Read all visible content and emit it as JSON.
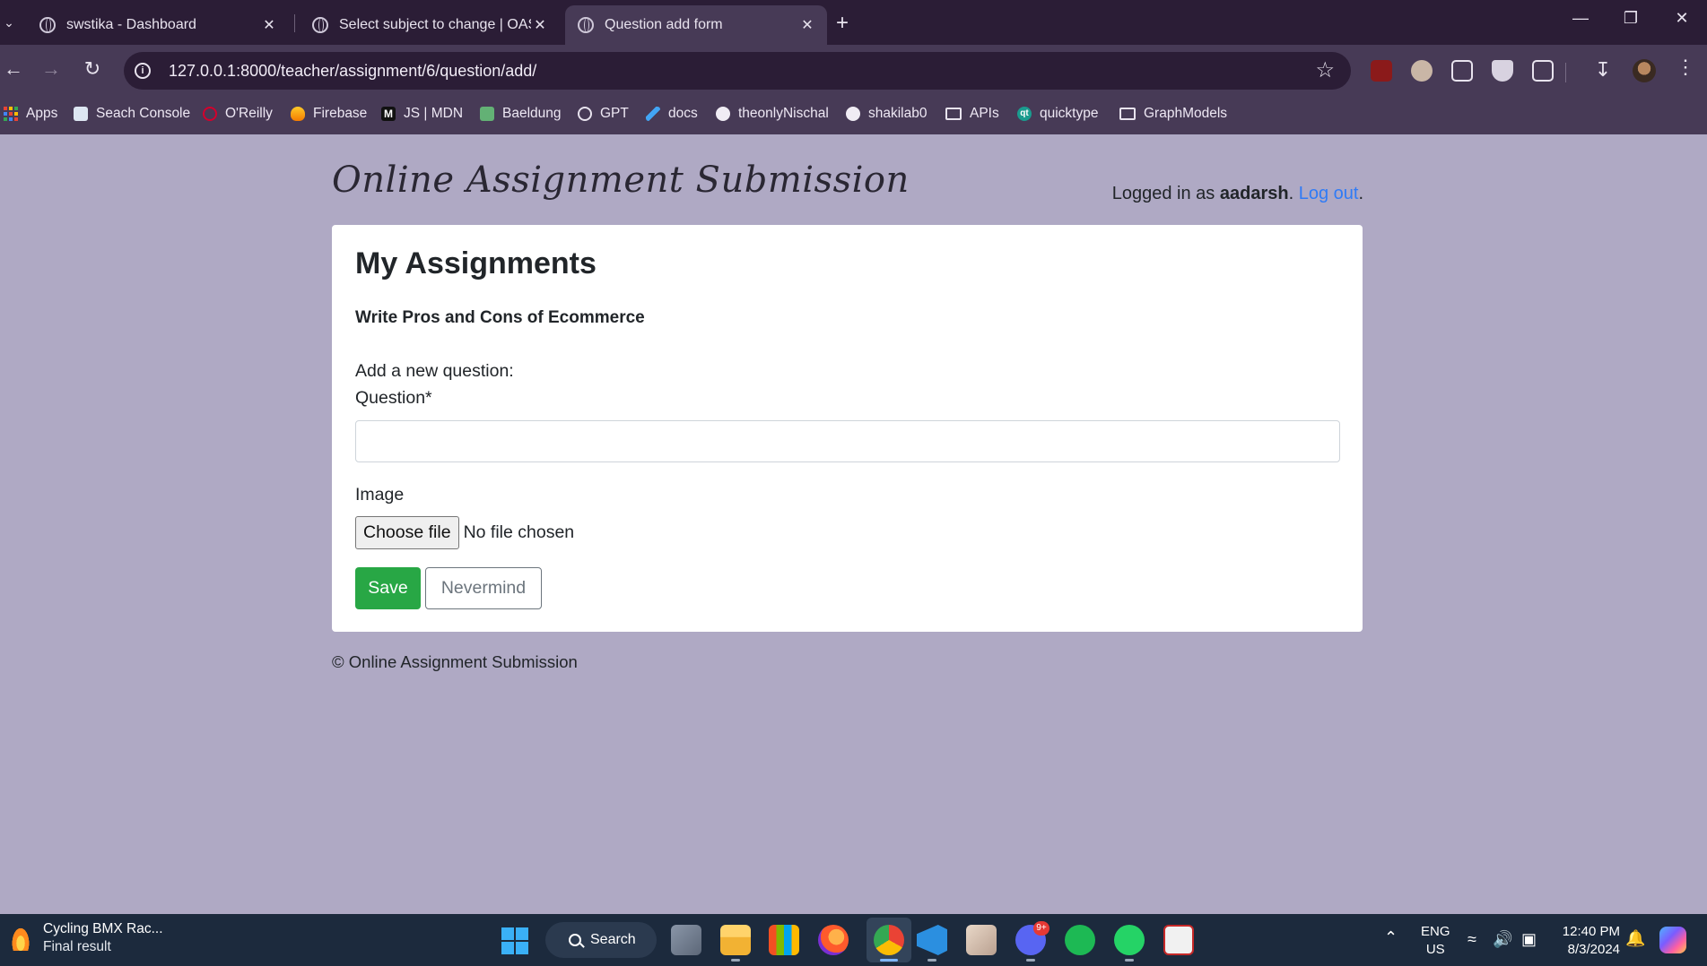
{
  "browser": {
    "tabs": [
      {
        "title": "swstika - Dashboard",
        "active": false
      },
      {
        "title": "Select subject to change | OAS Admin",
        "active": false
      },
      {
        "title": "Question add form",
        "active": true
      }
    ],
    "url": "127.0.0.1:8000/teacher/assignment/6/question/add/",
    "bookmarks": [
      {
        "label": "Apps",
        "icon": "apps-grid-icon"
      },
      {
        "label": "Seach Console",
        "icon": "search-console-icon"
      },
      {
        "label": "O'Reilly",
        "icon": "oreilly-icon"
      },
      {
        "label": "Firebase",
        "icon": "firebase-icon"
      },
      {
        "label": "JS | MDN",
        "icon": "mdn-icon"
      },
      {
        "label": "Baeldung",
        "icon": "baeldung-icon"
      },
      {
        "label": "GPT",
        "icon": "openai-icon"
      },
      {
        "label": "docs",
        "icon": "flutter-icon"
      },
      {
        "label": "theonlyNischal",
        "icon": "github-icon"
      },
      {
        "label": "shakilab0",
        "icon": "github-icon"
      },
      {
        "label": "APIs",
        "icon": "folder-icon"
      },
      {
        "label": "quicktype",
        "icon": "quicktype-icon"
      },
      {
        "label": "GraphModels",
        "icon": "folder-icon"
      }
    ],
    "colors": {
      "tabbar": "#2b1d36",
      "toolbar": "#473a56"
    }
  },
  "page": {
    "brand": "Online Assignment Submission",
    "login": {
      "prefix": "Logged in as ",
      "username": "aadarsh",
      "separator": ". ",
      "logout": "Log out",
      "suffix": "."
    },
    "heading": "My Assignments",
    "assignment_title": "Write Pros and Cons of Ecommerce",
    "form": {
      "intro": "Add a new question:",
      "question_label": "Question*",
      "question_value": "",
      "image_label": "Image",
      "choose_file": "Choose file",
      "file_status": "No file chosen",
      "save": "Save",
      "nevermind": "Nevermind"
    },
    "footer": "© Online Assignment Submission",
    "colors": {
      "background": "#afa9c4",
      "save": "#28a745",
      "link": "#2f7bf6"
    }
  },
  "taskbar": {
    "widget": {
      "title": "Cycling BMX Rac...",
      "subtitle": "Final result"
    },
    "search": "Search",
    "notification_badge": "9+",
    "language": {
      "line1": "ENG",
      "line2": "US"
    },
    "clock": {
      "time": "12:40 PM",
      "date": "8/3/2024"
    }
  }
}
